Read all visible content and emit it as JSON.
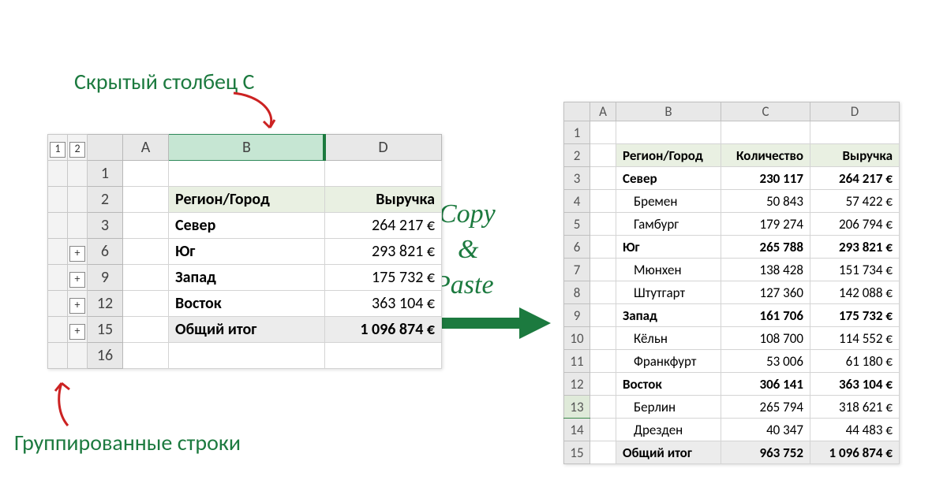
{
  "annotations": {
    "hidden_col": "Скрытый столбец С",
    "grouped_rows": "Группированные строки",
    "copy": "Copy",
    "amp": "&",
    "paste": "Paste"
  },
  "left": {
    "outline_levels": [
      "1",
      "2"
    ],
    "columns": [
      "A",
      "B",
      "D"
    ],
    "row_numbers_visible": [
      "1",
      "2",
      "3",
      "6",
      "9",
      "12",
      "15",
      "16"
    ],
    "plus_rows": [
      "6",
      "9",
      "12",
      "15"
    ],
    "data": {
      "header": {
        "b": "Регион/Город",
        "d": "Выручка"
      },
      "rows": [
        {
          "b": "Север",
          "d": "264 217 €"
        },
        {
          "b": "Юг",
          "d": "293 821 €"
        },
        {
          "b": "Запад",
          "d": "175 732 €"
        },
        {
          "b": "Восток",
          "d": "363 104 €"
        }
      ],
      "total": {
        "b": "Общий итог",
        "d": "1 096 874 €"
      }
    }
  },
  "right": {
    "columns": [
      "A",
      "B",
      "C",
      "D"
    ],
    "row_count": 15,
    "highlight_row": "13",
    "data": {
      "header": {
        "b": "Регион/Город",
        "c": "Количество",
        "d": "Выручка"
      },
      "rows": [
        {
          "b": "Север",
          "c": "230 117",
          "d": "264 217 €",
          "bold": true
        },
        {
          "b": "Бремен",
          "c": "50 843",
          "d": "57 422 €",
          "indent": true
        },
        {
          "b": "Гамбург",
          "c": "179 274",
          "d": "206 794 €",
          "indent": true
        },
        {
          "b": "Юг",
          "c": "265 788",
          "d": "293 821 €",
          "bold": true
        },
        {
          "b": "Мюнхен",
          "c": "138 428",
          "d": "151 734 €",
          "indent": true
        },
        {
          "b": "Штутгарт",
          "c": "127 360",
          "d": "142 088 €",
          "indent": true
        },
        {
          "b": "Запад",
          "c": "161 706",
          "d": "175 732 €",
          "bold": true
        },
        {
          "b": "Кёльн",
          "c": "108 700",
          "d": "114 552 €",
          "indent": true
        },
        {
          "b": "Франкфурт",
          "c": "53 006",
          "d": "61 180 €",
          "indent": true
        },
        {
          "b": "Восток",
          "c": "306 141",
          "d": "363 104 €",
          "bold": true
        },
        {
          "b": "Берлин",
          "c": "265 794",
          "d": "318 621 €",
          "indent": true
        },
        {
          "b": "Дрезден",
          "c": "40 347",
          "d": "44 483 €",
          "indent": true
        }
      ],
      "total": {
        "b": "Общий итог",
        "c": "963 752",
        "d": "1 096 874 €"
      }
    }
  }
}
